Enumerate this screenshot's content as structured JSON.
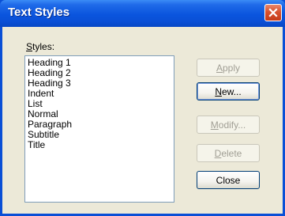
{
  "window": {
    "title": "Text Styles",
    "close_icon": "close-x-icon"
  },
  "styles": {
    "label_accel": "S",
    "label_rest": "tyles:",
    "items": [
      "Heading 1",
      "Heading 2",
      "Heading 3",
      "Indent",
      "List",
      "Normal",
      "Paragraph",
      "Subtitle",
      "Title"
    ]
  },
  "buttons": {
    "apply": {
      "accel": "A",
      "rest": "pply",
      "enabled": false
    },
    "new": {
      "accel": "N",
      "rest": "ew...",
      "enabled": true
    },
    "modify": {
      "accel": "M",
      "rest": "odify...",
      "enabled": false
    },
    "delete": {
      "accel": "D",
      "rest": "elete",
      "enabled": false
    },
    "close": {
      "label": "Close",
      "enabled": true
    }
  },
  "colors": {
    "titlebar": "#0a4fd6",
    "client": "#ece9d8",
    "close_button": "#d8522f"
  }
}
